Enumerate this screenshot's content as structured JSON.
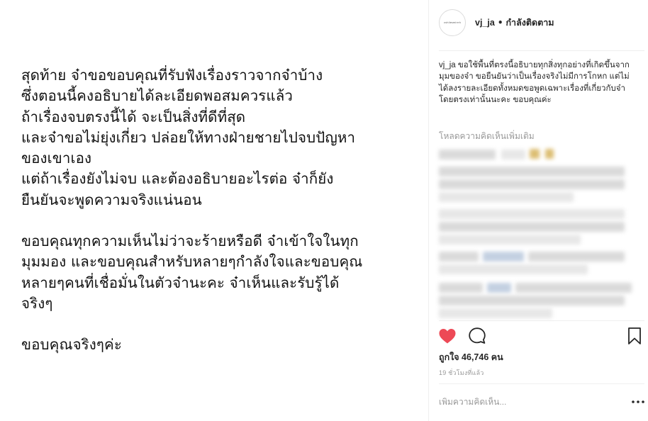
{
  "post": {
    "paragraphs": [
      "สุดท้าย จ๋าขอขอบคุณที่รับฟังเรื่องราวจากจ๋าบ้าง\nซึ่งตอนนี้คงอธิบายได้ละเอียดพอสมควรแล้ว\nถ้าเรื่องจบตรงนี้ได้ จะเป็นสิ่งที่ดีที่สุด\nและจ๋าขอไม่ยุ่งเกี่ยว ปล่อยให้ทางฝ่ายชายไปจบปัญหา\nของเขาเอง\nแต่ถ้าเรื่องยังไม่จบ และต้องอธิบายอะไรต่อ จ๋าก็ยัง\nยืนยันจะพูดความจริงแน่นอน",
      "ขอบคุณทุกความเห็นไม่ว่าจะร้ายหรือดี จ๋าเข้าใจในทุก\nมุมมอง และขอบคุณสำหรับหลายๆกำลังใจและขอบคุณ\nหลายๆคนที่เชื่อมั่นในตัวจ๋านะคะ จ๋าเห็นและรับรู้ได้\nจริงๆ",
      "ขอบคุณจริงๆค่ะ"
    ]
  },
  "header": {
    "avatar_text": "vvhilesmirrrk",
    "username": "vj_ja",
    "separator": "•",
    "follow_status": "กำลังติดตาม"
  },
  "caption": {
    "username": "vj_ja",
    "text": "ขอใช้พื้นที่ตรงนี้อธิบายทุกสิ่งทุกอย่างที่เกิดขึ้นจากมุมของจ๋า ขอยืนยันว่าเป็นเรื่องจริงไม่มีการโกหก แต่ไม่ได้ลงรายละเอียดทั้งหมดขอพูดเฉพาะเรื่องที่เกี่ยวกับจ๋าโดยตรงเท่านั้นนะคะ ขอบคุณค่ะ"
  },
  "load_more_label": "โหลดความคิดเห็นเพิ่มเติม",
  "likes": {
    "label": "ถูกใจ 46,746 คน"
  },
  "timestamp": "19 ชั่วโมงที่แล้ว",
  "comment_box": {
    "placeholder": "เพิ่มความคิดเห็น..."
  },
  "icons": {
    "like": "heart-icon",
    "comment": "comment-icon",
    "save": "bookmark-icon",
    "more": "more-icon"
  },
  "colors": {
    "like_red": "#ed4956",
    "text": "#262626",
    "muted": "#999999",
    "divider": "#efefef"
  }
}
